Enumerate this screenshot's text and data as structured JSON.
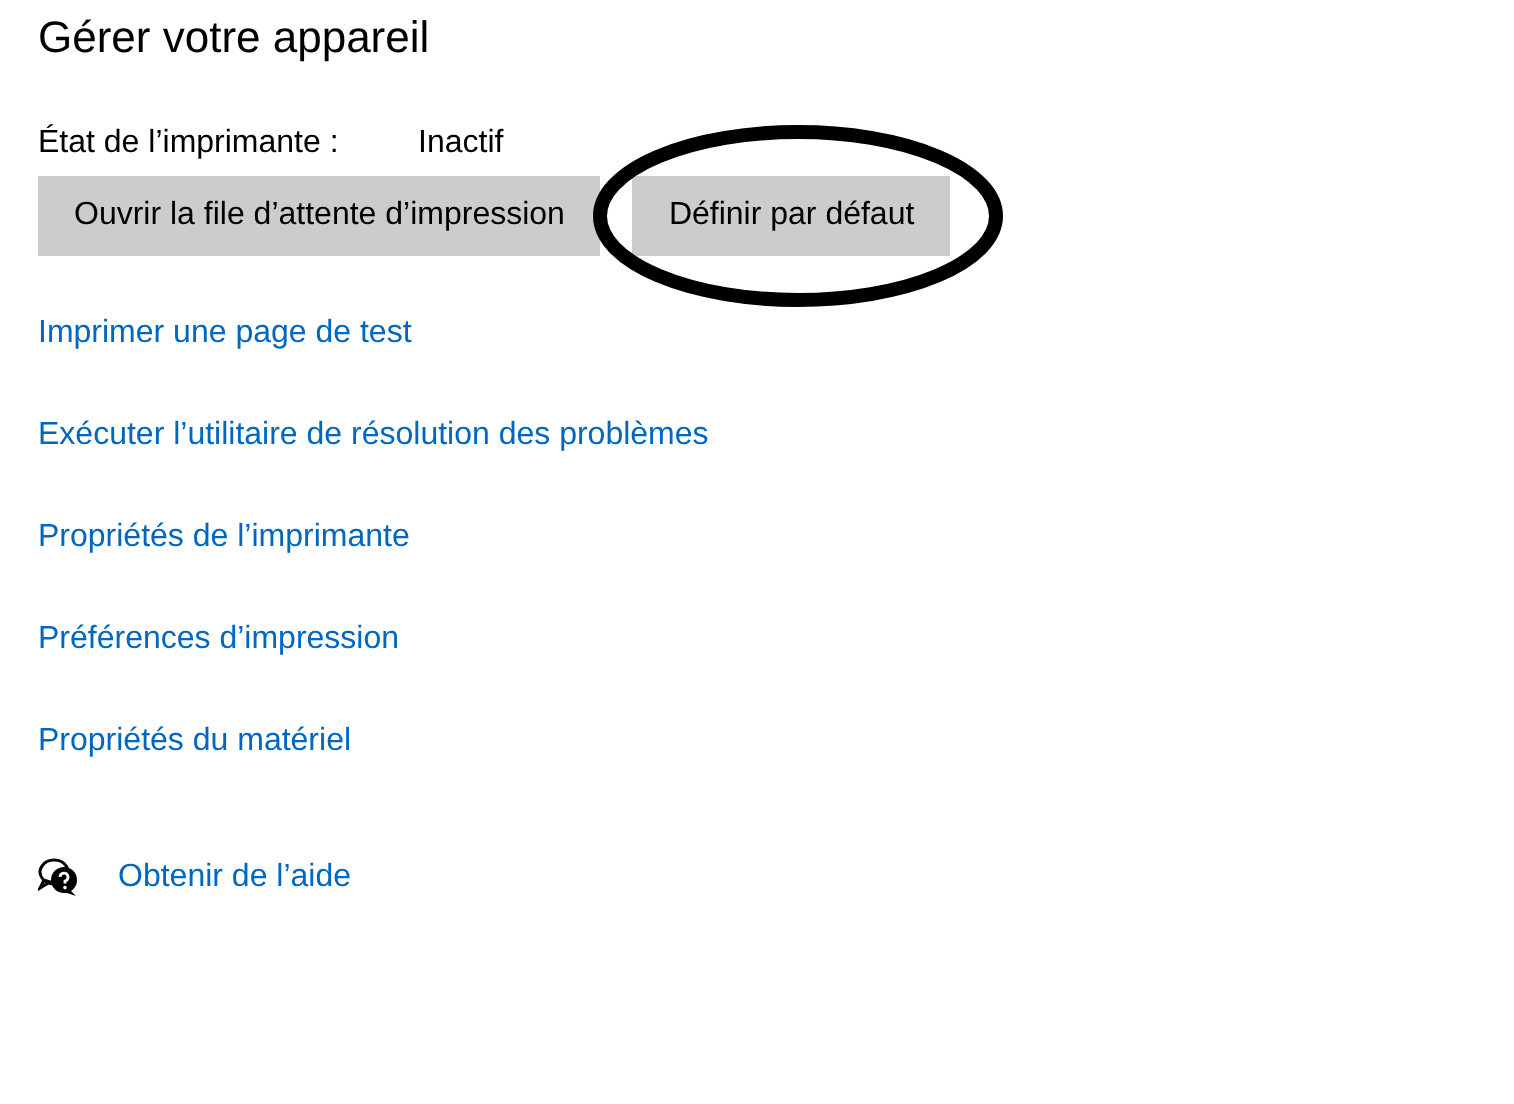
{
  "title": "Gérer votre appareil",
  "status": {
    "label": "État de l’imprimante :",
    "value": "Inactif"
  },
  "buttons": [
    {
      "label": "Ouvrir la file d’attente d’impression",
      "highlighted": false
    },
    {
      "label": "Définir par défaut",
      "highlighted": true
    }
  ],
  "links": [
    "Imprimer une page de test",
    "Exécuter l’utilitaire de résolution des problèmes",
    "Propriétés de l’imprimante",
    "Préférences d’impression",
    "Propriétés du matériel"
  ],
  "help": {
    "label": "Obtenir de l’aide"
  }
}
